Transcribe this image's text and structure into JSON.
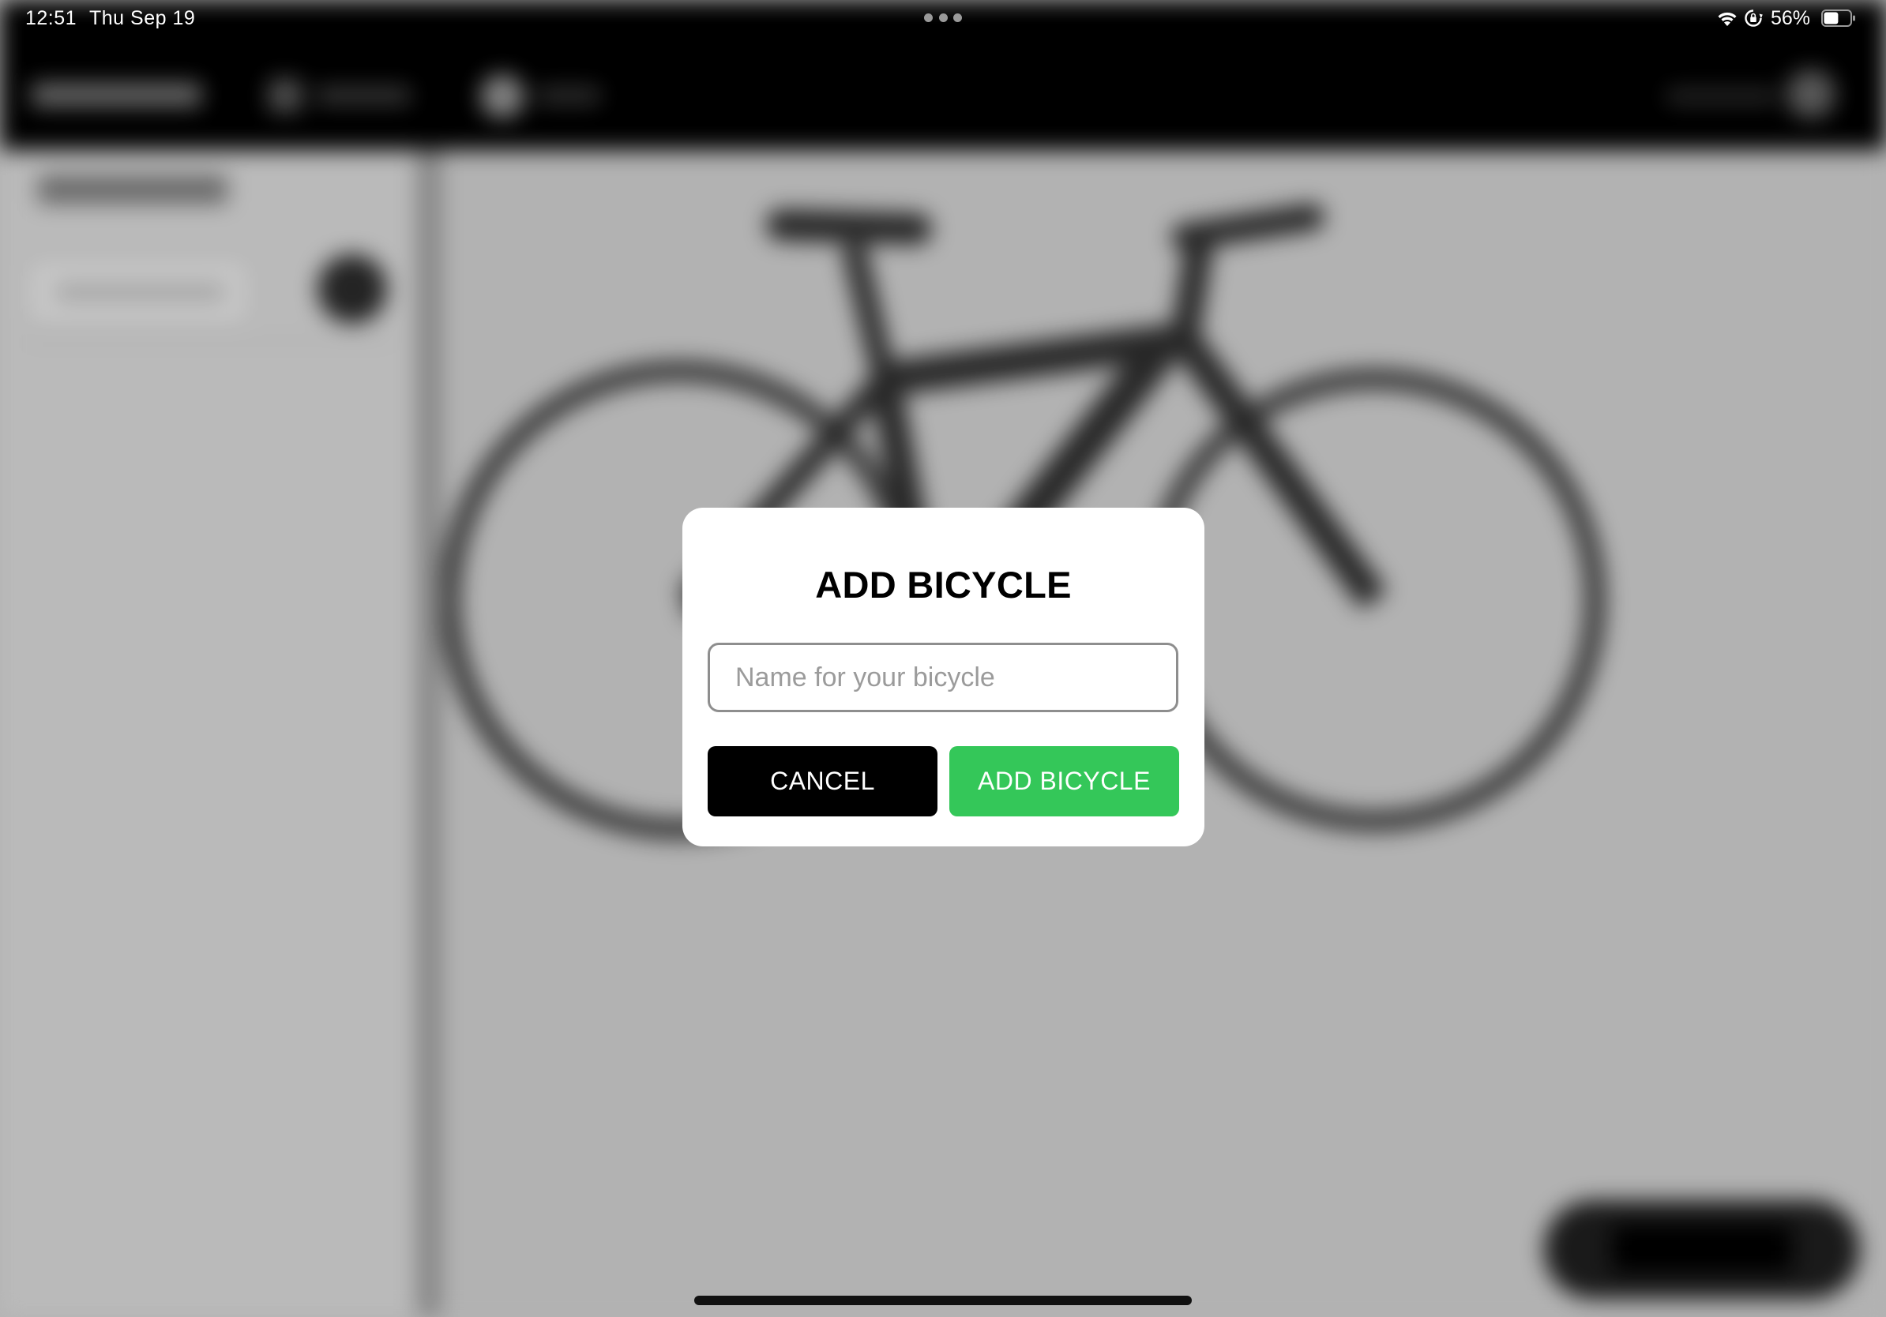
{
  "status_bar": {
    "time": "12:51",
    "date": "Thu Sep 19",
    "battery_percent": "56%",
    "battery_level": 0.56,
    "icons": [
      "multitasking-dots-icon",
      "wifi-icon",
      "orientation-lock-icon",
      "battery-icon"
    ]
  },
  "dialog": {
    "title": "ADD BICYCLE",
    "name_input": {
      "placeholder": "Name for your bicycle",
      "value": ""
    },
    "cancel_label": "CANCEL",
    "add_label": "ADD BICYCLE"
  },
  "colors": {
    "accent_green": "#34c759",
    "cancel_black": "#000000",
    "topbar_black": "#000000"
  }
}
